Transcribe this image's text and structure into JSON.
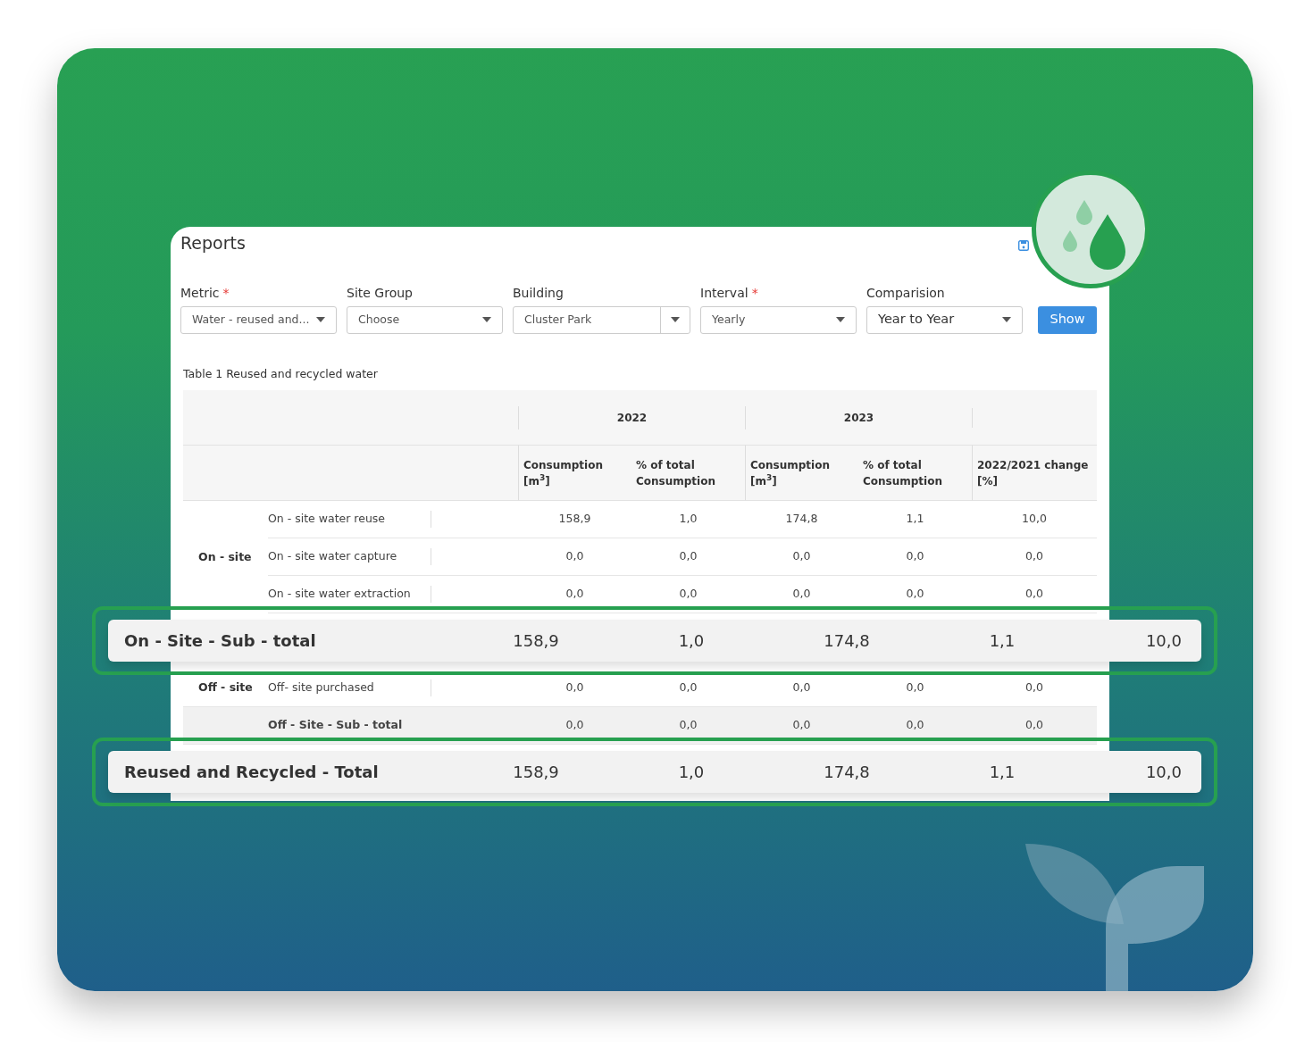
{
  "window": {
    "title": "Reports"
  },
  "filters": [
    {
      "label": "Metric",
      "required_mark": "*",
      "value": "Water - reused and...",
      "kind": "select"
    },
    {
      "label": "Site Group",
      "value": "Choose",
      "kind": "select"
    },
    {
      "label": "Building",
      "value": "Cluster Park",
      "kind": "combo"
    },
    {
      "label": "Interval",
      "required_mark": "*",
      "value": "Yearly",
      "kind": "select"
    },
    {
      "label": "Comparision",
      "value": "Year to Year",
      "kind": "large"
    }
  ],
  "show_button": "Show",
  "table": {
    "caption": "Table 1 Reused and recycled water",
    "years": [
      "2022",
      "2023"
    ],
    "columns": [
      "Consumption [m$^{3}$]",
      "% of total Consumption",
      "Consumption [m$^{3}$]",
      "% of total Consumption",
      "2022/2021 change [%]"
    ],
    "sections": [
      {
        "kind": "group",
        "label": "On - site",
        "rows": [
          {
            "label": "On - site water reuse",
            "values": [
              "158,9",
              "1,0",
              "174,8",
              "1,1",
              "10,0"
            ]
          },
          {
            "label": "On - site water capture",
            "values": [
              "0,0",
              "0,0",
              "0,0",
              "0,0",
              "0,0"
            ]
          },
          {
            "label": "On - site water extraction",
            "values": [
              "0,0",
              "0,0",
              "0,0",
              "0,0",
              "0,0"
            ]
          }
        ]
      },
      {
        "kind": "highlight",
        "label": "On - Site - Sub - total",
        "values": [
          "158,9",
          "1,0",
          "174,8",
          "1,1",
          "10,0"
        ]
      },
      {
        "kind": "group",
        "label": "Off - site",
        "rows": [
          {
            "label": "Off- site purchased",
            "values": [
              "0,0",
              "0,0",
              "0,0",
              "0,0",
              "0,0"
            ]
          }
        ]
      },
      {
        "kind": "subtotal",
        "label": "Off - Site - Sub - total",
        "values": [
          "0,0",
          "0,0",
          "0,0",
          "0,0",
          "0,0"
        ]
      },
      {
        "kind": "highlight",
        "label": "Reused and Recycled - Total",
        "values": [
          "158,9",
          "1,0",
          "174,8",
          "1,1",
          "10,0"
        ]
      }
    ]
  }
}
